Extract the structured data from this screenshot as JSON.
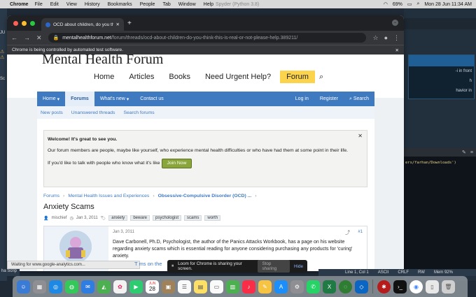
{
  "menubar": {
    "app": "Chrome",
    "items": [
      "File",
      "Edit",
      "View",
      "History",
      "Bookmarks",
      "People",
      "Tab",
      "Window",
      "Help"
    ],
    "center_title": "Spyder (Python 3.8)",
    "battery": "69%",
    "datetime": "Mon 28 Jun  11:34 AM"
  },
  "browser": {
    "tab_title": "OCD about children, do you thi",
    "url_host": "mentalhealthforum.net",
    "url_path": "/forum/threads/ocd-about-children-do-you-think-this-is-real-or-not-please-help.389211/",
    "automation_notice": "Chrome is being controlled by automated test software.",
    "status_text": "Waiting for www.google-analytics.com..."
  },
  "site": {
    "logo": "Mental Health Forum",
    "topnav": [
      "Home",
      "Articles",
      "Books",
      "Need Urgent Help?"
    ],
    "topnav_active": "Forum",
    "bluenav": {
      "home": "Home",
      "forums": "Forums",
      "whats_new": "What's new",
      "contact": "Contact us",
      "login": "Log in",
      "register": "Register",
      "search": "Search"
    },
    "subnav": [
      "New posts",
      "Unanswered threads",
      "Search forums"
    ],
    "notice": {
      "welcome": "Welcome! It's great to see you.",
      "body": "Our forum members are people, maybe like yourself, who experience mental health difficulties or who have had them at some point in their life.",
      "cta_text": "If you'd like to talk with people who know what it's like",
      "join_label": "Join Now"
    },
    "breadcrumbs": [
      "Forums",
      "Mental Health Issues and Experiences",
      "Obsessive-Compulsive Disorder (OCD) ..."
    ],
    "thread": {
      "title": "Anxiety Scams",
      "author": "mischief",
      "date": "Jan 3, 2011",
      "tags": [
        "anxiety",
        "beware",
        "psychologist",
        "scams",
        "worth"
      ]
    },
    "post": {
      "date": "Jan 3, 2011",
      "number": "#1",
      "body": "Dave Carbonell, Ph.D, Psychologist, the author of the Panics Attacks Workbook, has a page on his website regarding anxiety scams which is essential reading for anyone considering purchasing any products for 'curing' anxiety.",
      "link_peek": "ms on the",
      "link_prefix": "T"
    }
  },
  "loom": {
    "message": "Loom for Chrome is sharing your screen.",
    "stop": "Stop sharing",
    "hide": "Hide"
  },
  "right_pane": {
    "text_line1": "-i in front",
    "text_line2": "h",
    "text_line3": "havior in",
    "code": "ers/farhan/Downloads')",
    "status": [
      "Line 1, Col 1",
      "ASCII",
      "CRLF",
      "RW",
      "Mem 92%"
    ]
  },
  "left_pane": {
    "label1": "JU",
    "label2": "Sc",
    "status": "ha Scrip"
  },
  "dock": {
    "calendar_month": "JUN",
    "calendar_day": "28"
  },
  "colors": {
    "forum_blue": "#3f79c0",
    "forum_yellow": "#fbd34d",
    "join_green": "#8aa63a"
  }
}
